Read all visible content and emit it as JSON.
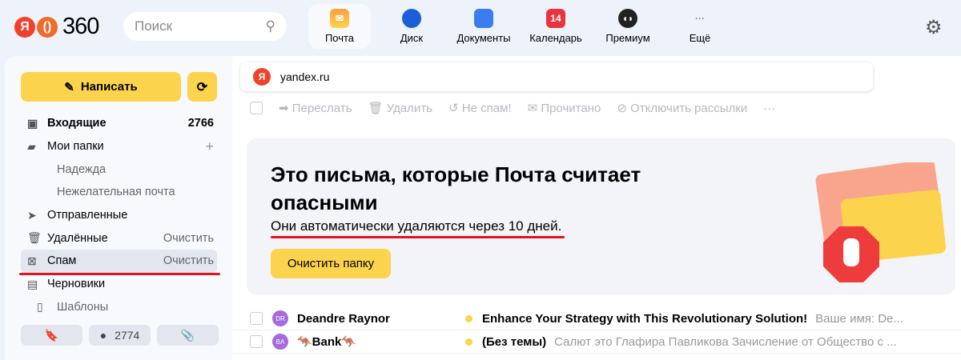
{
  "header": {
    "logo_text": "360",
    "search_placeholder": "Поиск",
    "apps": [
      {
        "label": "Почта"
      },
      {
        "label": "Диск"
      },
      {
        "label": "Документы"
      },
      {
        "label": "Календарь",
        "badge": "14"
      },
      {
        "label": "Премиум"
      },
      {
        "label": "Ещё"
      }
    ]
  },
  "sidebar": {
    "compose": "Написать",
    "items": [
      {
        "label": "Входящие",
        "count": "2766"
      },
      {
        "label": "Мои папки",
        "action": "+"
      },
      {
        "label": "Надежда"
      },
      {
        "label": "Нежелательная почта"
      },
      {
        "label": "Отправленные"
      },
      {
        "label": "Удалённые",
        "action": "Очистить"
      },
      {
        "label": "Спам",
        "action": "Очистить"
      },
      {
        "label": "Черновики"
      },
      {
        "label": "Шаблоны"
      }
    ],
    "unread_count": "2774"
  },
  "main": {
    "address": "yandex.ru",
    "toolbar": [
      "Переслать",
      "Удалить",
      "Не спам!",
      "Прочитано",
      "Отключить рассылки",
      "···"
    ],
    "banner": {
      "title": "Это письма, которые Почта считает опасными",
      "subtitle": "Они автоматически удаляются через 10 дней.",
      "button": "Очистить папку"
    },
    "messages": [
      {
        "initials": "DR",
        "from": "Deandre Raynor",
        "subject": "Enhance Your Strategy with This Revolutionary Solution!",
        "preview": "Ваше имя: De..."
      },
      {
        "initials": "BA",
        "from": "🦘Bank🦘",
        "subject": "(Без темы)",
        "preview": "Салют это Глафира Павликова Зачисление от Общество с ..."
      }
    ]
  }
}
